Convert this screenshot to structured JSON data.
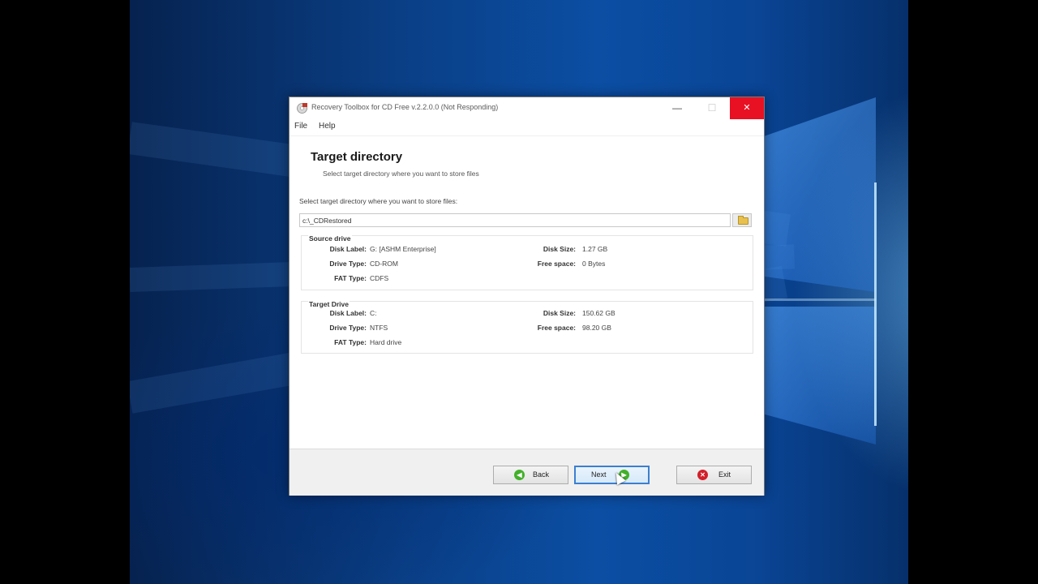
{
  "window": {
    "title": "Recovery Toolbox for CD Free v.2.2.0.0 (Not Responding)",
    "minimize_glyph": "—",
    "maximize_glyph": "☐",
    "close_glyph": "✕"
  },
  "menu": {
    "file": "File",
    "help": "Help"
  },
  "header": {
    "title": "Target directory",
    "subtitle": "Select target directory where you want to store files"
  },
  "target": {
    "label": "Select target directory where you want to store files:",
    "path": "c:\\_CDRestored"
  },
  "source_drive": {
    "title": "Source drive",
    "disk_label_caption": "Disk Label:",
    "disk_label": "G: [ASHM Enterprise]",
    "drive_type_caption": "Drive Type:",
    "drive_type": "CD-ROM",
    "fat_type_caption": "FAT Type:",
    "fat_type": "CDFS",
    "disk_size_caption": "Disk Size:",
    "disk_size": "1.27 GB",
    "free_space_caption": "Free space:",
    "free_space": "0 Bytes"
  },
  "target_drive": {
    "title": "Target Drive",
    "disk_label_caption": "Disk Label:",
    "disk_label": "C:",
    "drive_type_caption": "Drive Type:",
    "drive_type": "NTFS",
    "fat_type_caption": "FAT Type:",
    "fat_type": "Hard drive",
    "disk_size_caption": "Disk Size:",
    "disk_size": "150.62 GB",
    "free_space_caption": "Free space:",
    "free_space": "98.20 GB"
  },
  "buttons": {
    "back": "Back",
    "next": "Next",
    "exit": "Exit"
  },
  "icons": {
    "app": "recovery-toolbox-icon",
    "browse": "folder-icon",
    "back": "green-arrow-left-icon",
    "next": "green-arrow-right-icon",
    "exit": "red-x-icon"
  },
  "colors": {
    "close_button": "#e81123",
    "accent": "#3c7fd0",
    "ok_green": "#43b02a",
    "exit_red": "#d2202a"
  }
}
